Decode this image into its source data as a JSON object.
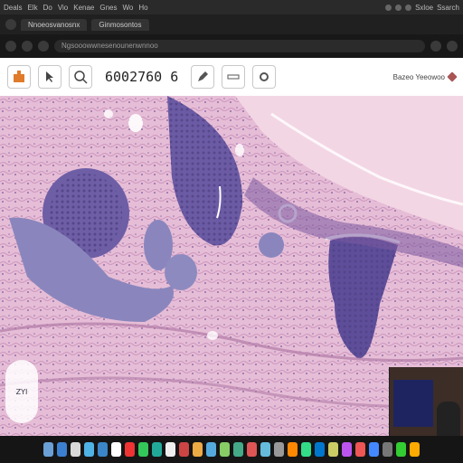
{
  "menubar": {
    "items": [
      "Deals",
      "Elk",
      "Do",
      "Vio",
      "Kenae",
      "Gnes",
      "Wo",
      "Ho"
    ],
    "tray_items": [
      "Sxloe",
      "Ssarch"
    ]
  },
  "browser": {
    "tabs": [
      "Nnoeosvanosnx",
      "Ginmosontos"
    ],
    "url": "Ngsooowwnesenounenwnnoo"
  },
  "toolbar": {
    "page_number": "6002760 6",
    "brand": "Bazeo Yeeowoo"
  },
  "zoom": {
    "label": "ZYI"
  },
  "dock": {
    "icon_colors": [
      "#6aa0d6",
      "#3b7fd0",
      "#d9d9d9",
      "#4fb3e6",
      "#3a86c8",
      "#ffffff",
      "#e33",
      "#34c759",
      "#2a9",
      "#eee",
      "#c44",
      "#ea4",
      "#5ad",
      "#8c6",
      "#4a8",
      "#d55",
      "#6bd",
      "#999",
      "#f80",
      "#3d8",
      "#07c",
      "#cc6",
      "#b5e",
      "#e55",
      "#48f",
      "#777",
      "#3c3",
      "#fa0"
    ]
  },
  "colors": {
    "tissue_bg": "#e6bdd6",
    "nuclei": "#5d4a8c",
    "stroma": "#d59fc4"
  }
}
